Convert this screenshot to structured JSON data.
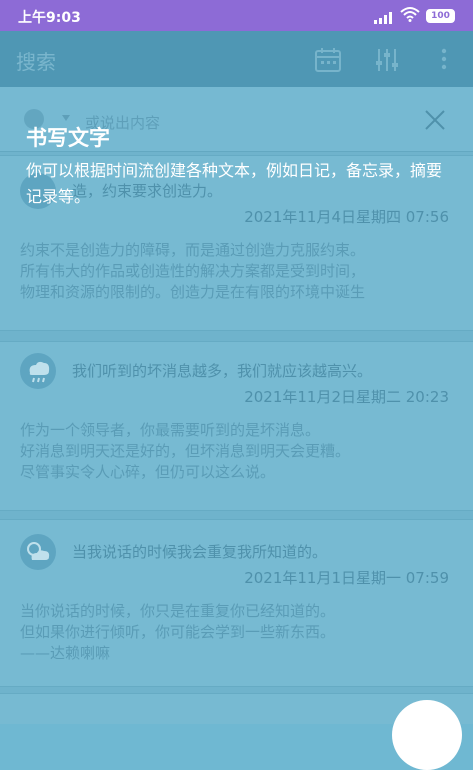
{
  "status_bar": {
    "time": "上午9:03",
    "battery": "100"
  },
  "toolbar": {
    "title": "搜索",
    "icons": [
      "calendar-icon",
      "filter-icon",
      "more-icon"
    ]
  },
  "input": {
    "placeholder": "或说出内容"
  },
  "hint": {
    "title": "书写文字",
    "description": "你可以根据时间流创建各种文本，例如日记，备忘录，摘要记录等。"
  },
  "entries": [
    {
      "headline": "造，约束要求创造力。",
      "date": "2021年11月4日星期四 07:56",
      "body": [
        "约束不是创造力的障碍，而是通过创造力克服约束。",
        "所有伟大的作品或创造性的解决方案都是受到时间，",
        "物理和资源的限制的。创造力是在有限的环境中诞生"
      ]
    },
    {
      "headline": "我们听到的坏消息越多，我们就应该越高兴。",
      "date": "2021年11月2日星期二 20:23",
      "body": [
        "作为一个领导者，你最需要听到的是坏消息。",
        "好消息到明天还是好的，但坏消息到明天会更糟。",
        "尽管事实令人心碎，但仍可以这么说。"
      ]
    },
    {
      "headline": "当我说话的时候我会重复我所知道的。",
      "date": "2021年11月1日星期一 07:59",
      "body": [
        "当你说话的时候，你只是在重复你已经知道的。",
        "但如果你进行倾听，你可能会学到一些新东西。",
        "——达赖喇嘛"
      ]
    }
  ]
}
